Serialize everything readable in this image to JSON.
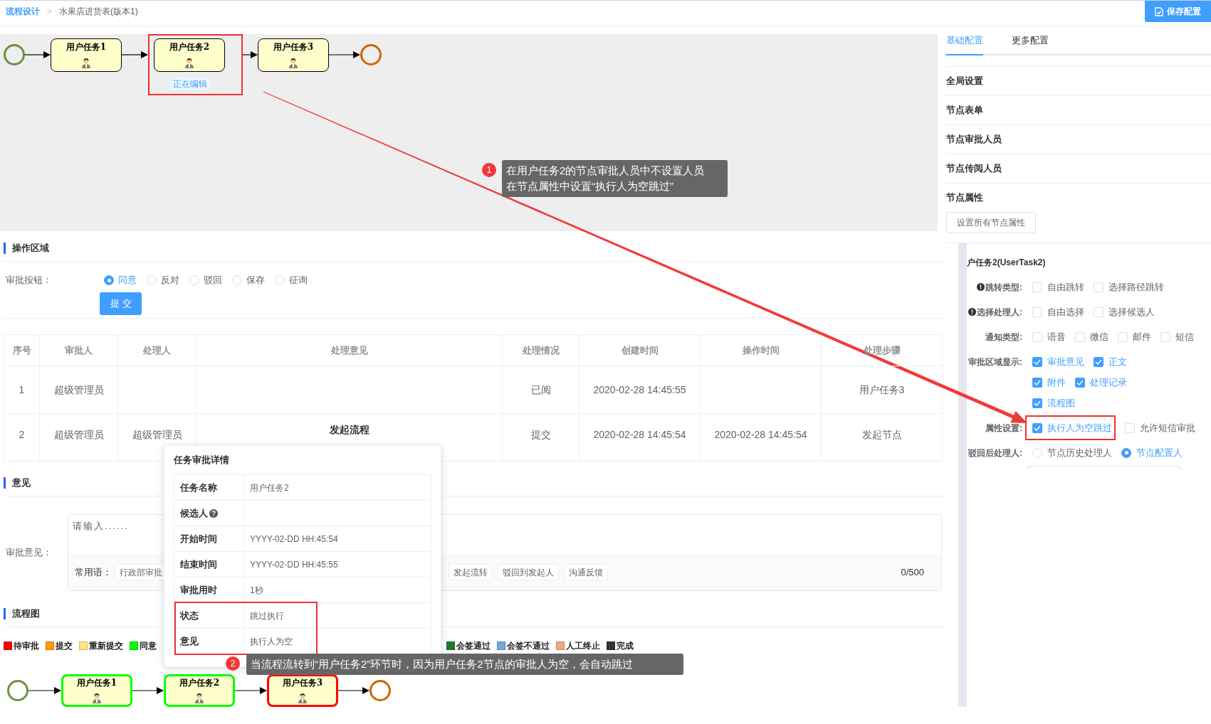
{
  "breadcrumb": [
    {
      "kind": "link",
      "label": "流程设计"
    },
    {
      "kind": "separator",
      "label": ">"
    },
    {
      "kind": "current",
      "label": "水果店进货表(版本1)"
    }
  ],
  "save_button": "保存配置",
  "top_diagram": {
    "nodes": [
      {
        "kind": "start"
      },
      {
        "kind": "task",
        "label": "用户任务1",
        "highlighted": false,
        "editing": false
      },
      {
        "kind": "task",
        "label": "用户任务2",
        "highlighted": true,
        "editing": true
      },
      {
        "kind": "task",
        "label": "用户任务3",
        "highlighted": false,
        "editing": false
      },
      {
        "kind": "end"
      }
    ],
    "editing_badge": "正在编辑"
  },
  "operation_area": {
    "title": "操作区域",
    "label": "审批按钮：",
    "options": [
      {
        "label": "同意",
        "selected": true
      },
      {
        "label": "反对",
        "selected": false
      },
      {
        "label": "驳回",
        "selected": false
      },
      {
        "label": "保存",
        "selected": false
      },
      {
        "label": "征询",
        "selected": false
      }
    ],
    "submit_button": "提交"
  },
  "table": {
    "columns": [
      "序号",
      "审批人",
      "处理人",
      "处理意见",
      "处理情况",
      "创建时间",
      "操作时间",
      "处理步骤"
    ],
    "rows": [
      {
        "cells": [
          "1",
          "超级管理员",
          null,
          null,
          "已阅",
          "2020-02-28 14:45:55",
          null,
          "用户任务3"
        ]
      },
      {
        "cells": [
          "2",
          "超级管理员",
          "超级管理员",
          {
            "text": "发起流程",
            "bold": true
          },
          "提交",
          "2020-02-28 14:45:54",
          "2020-02-28 14:45:54",
          "发起节点"
        ]
      }
    ]
  },
  "opinion": {
    "title": "意见",
    "label": "审批意见：",
    "placeholder": "请输入......",
    "phrases_label": "常用语：",
    "phrases": [
      "行政部审批",
      "发起流转",
      "驳回到发起人",
      "沟通反馈"
    ],
    "counter": "0/500"
  },
  "flow_chart": {
    "title": "流程图",
    "legend": [
      {
        "label": "待审批",
        "color": "#ff0000"
      },
      {
        "label": "提交",
        "color": "#ff9900"
      },
      {
        "label": "重新提交",
        "color": "#ffe680"
      },
      {
        "label": "同意",
        "color": "#00ff00"
      },
      {
        "label": "会签通过",
        "color": "#1e7b34"
      },
      {
        "label": "会签不通过",
        "color": "#6fa8dc"
      },
      {
        "label": "人工终止",
        "color": "#f4a582"
      },
      {
        "label": "完成",
        "color": "#333333"
      }
    ],
    "nodes": [
      {
        "kind": "start"
      },
      {
        "kind": "task",
        "label": "用户任务1",
        "color": "#00ff00"
      },
      {
        "kind": "task",
        "label": "用户任务2",
        "color": "#00ff00"
      },
      {
        "kind": "task",
        "label": "用户任务3",
        "color": "#ff0000"
      },
      {
        "kind": "end"
      }
    ]
  },
  "popover": {
    "title": "任务审批详情",
    "rows": [
      {
        "label": "任务名称",
        "value": "用户任务2",
        "help": false,
        "highlighted": false
      },
      {
        "label": "候选人",
        "help": true,
        "highlighted": false
      },
      {
        "label": "开始时间",
        "value": "YYYY-02-DD HH:45:54",
        "help": false,
        "highlighted": false
      },
      {
        "label": "结束时间",
        "value": "YYYY-02-DD HH:45:55",
        "help": false,
        "highlighted": false
      },
      {
        "label": "审批用时",
        "value": "1秒",
        "help": false,
        "highlighted": false
      },
      {
        "label": "状态",
        "value": "跳过执行",
        "help": false,
        "highlighted": true
      },
      {
        "label": "意见",
        "value": "执行人为空",
        "help": false,
        "highlighted": true
      }
    ]
  },
  "annotations": [
    {
      "number": "1",
      "lines": [
        "在用户任务2的节点审批人员中不设置人员",
        "在节点属性中设置“执行人为空跳过”"
      ]
    },
    {
      "number": "2",
      "lines": [
        "当流程流转到“用户任务2”环节时，因为用户任务2节点的审批人为空，会自动跳过"
      ]
    }
  ],
  "config": {
    "tabs": [
      {
        "label": "基础配置",
        "selected": true
      },
      {
        "label": "更多配置",
        "selected": false
      }
    ],
    "sections": [
      "全局设置",
      "节点表单",
      "节点审批人员",
      "节点传阅人员",
      "节点属性"
    ],
    "set_all_button": "设置所有节点属性",
    "node_title": "户任务2(UserTask2)",
    "fields": [
      {
        "label": "跳转类型:",
        "info": true,
        "kind": "checkbox",
        "option_rows": [
          [
            {
              "label": "自由跳转",
              "checked": false
            },
            {
              "label": "选择路径跳转",
              "checked": false
            }
          ]
        ]
      },
      {
        "label": "选择处理人:",
        "info": true,
        "kind": "checkbox",
        "option_rows": [
          [
            {
              "label": "自由选择",
              "checked": false
            },
            {
              "label": "选择候选人",
              "checked": false
            }
          ]
        ]
      },
      {
        "label": "通知类型:",
        "info": false,
        "kind": "checkbox",
        "option_rows": [
          [
            {
              "label": "语音",
              "checked": false
            },
            {
              "label": "微信",
              "checked": false
            },
            {
              "label": "邮件",
              "checked": false
            },
            {
              "label": "短信",
              "checked": false
            }
          ]
        ]
      },
      {
        "label": "审批区域显示:",
        "info": false,
        "kind": "checkbox",
        "option_rows": [
          [
            {
              "label": "审批意见",
              "checked": true
            },
            {
              "label": "正文",
              "checked": true
            }
          ],
          [
            {
              "label": "附件",
              "checked": true
            },
            {
              "label": "处理记录",
              "checked": true
            }
          ],
          [
            {
              "label": "流程图",
              "checked": true
            }
          ]
        ]
      },
      {
        "label": "属性设置:",
        "info": false,
        "kind": "checkbox",
        "option_rows": [
          [
            {
              "label": "执行人为空跳过",
              "checked": true,
              "highlighted": true
            },
            {
              "label": "允许短信审批",
              "checked": false,
              "highlighted": false
            }
          ]
        ]
      },
      {
        "label": "驳回后处理人:",
        "info": false,
        "kind": "radio",
        "option_rows": [
          [
            {
              "label": "节点历史处理人",
              "selected": false
            },
            {
              "label": "节点配置人",
              "selected": true
            }
          ]
        ]
      }
    ]
  }
}
